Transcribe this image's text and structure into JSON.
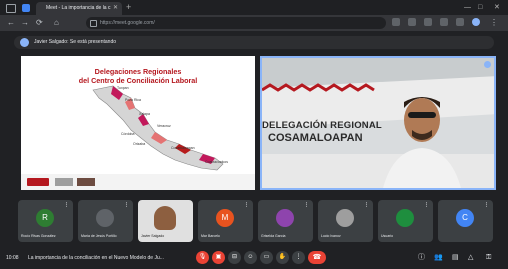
{
  "browser": {
    "tab_title": "Meet - La importancia de la c",
    "url": "https://meet.google.com/",
    "nav_icons": [
      "←",
      "→",
      "⟳",
      "⌂"
    ],
    "window_controls": [
      "—",
      "□",
      "✕"
    ]
  },
  "meet": {
    "presenting_text": "Javier Salgado: Se está presentando",
    "slide": {
      "title": "Delegaciones Regionales",
      "subtitle": "del Centro de Conciliación Laboral",
      "map_labels": [
        "Tuxpan",
        "Poza Rica",
        "Xalapa",
        "Veracruz",
        "Córdoba",
        "Orizaba",
        "Cosamaloapan",
        "Coatzacoalcos"
      ]
    },
    "video_banner": {
      "line1": "DELEGACIÓN REGIONAL",
      "line2": "COSAMALOAPAN"
    },
    "participants": [
      {
        "initial": "R",
        "name": "Rocío Rivas González",
        "color": "#2e7d32"
      },
      {
        "initial": "",
        "name": "María de Jesús Portillo",
        "color": "#5f6368"
      },
      {
        "initial": "",
        "name": "Javier Salgado",
        "color": "#5f6368"
      },
      {
        "initial": "M",
        "name": "Mar Barcelo",
        "color": "#e8531f"
      },
      {
        "initial": "",
        "name": "Griselda García",
        "color": "#8e44ad"
      },
      {
        "initial": "",
        "name": "Lucio Ivanov",
        "color": "#9e9e9e"
      },
      {
        "initial": "",
        "name": "Usuario",
        "color": "#1e8e3e"
      },
      {
        "initial": "C",
        "name": "",
        "color": "#4285f4"
      }
    ],
    "bottom": {
      "time": "10:08",
      "title": "La importancia de la conciliación en el Nuevo Modelo de Ju..."
    }
  }
}
